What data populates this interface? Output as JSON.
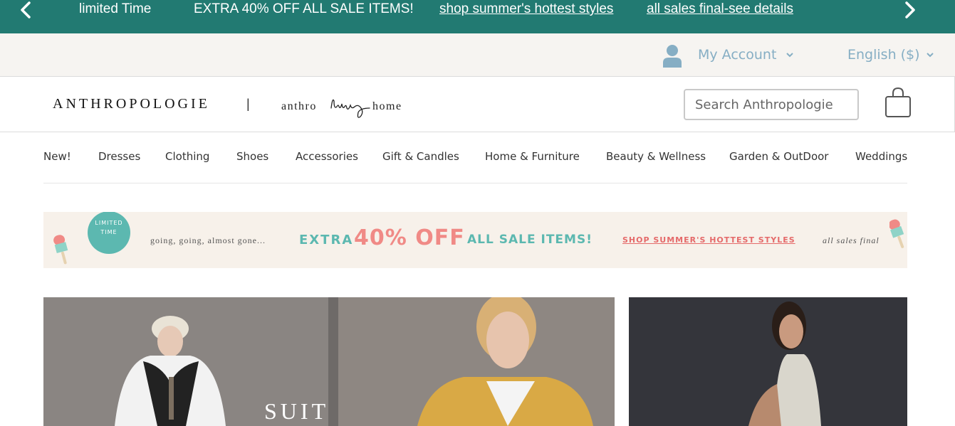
{
  "promo_bar": {
    "limited_label": "limited Time",
    "offer_label": "EXTRA 40% OFF ALL SALE ITEMS!",
    "shop_link": "shop summer's hottest styles",
    "details_link": "all sales final-see details",
    "prev_icon": "chevron-left-icon",
    "next_icon": "chevron-right-icon",
    "bg_color": "#227a72"
  },
  "utility_bar": {
    "account_label": "My Account",
    "account_icon": "user-icon",
    "language_label": "English ($)",
    "text_color": "#86aec4"
  },
  "header": {
    "logo_text": "ANTHROPOLOGIE",
    "separator": "|",
    "home_logo": "anthro living home",
    "search_placeholder": "Search Anthropologie",
    "cart_icon": "shopping-bag-icon"
  },
  "nav": {
    "items": [
      "New!",
      "Dresses",
      "Clothing",
      "Shoes",
      "Accessories",
      "Gift & Candles",
      "Home & Furniture",
      "Beauty & Wellness",
      "Garden & OutDoor",
      "Weddings"
    ]
  },
  "sale_banner": {
    "badge_line1": "LIMITED",
    "badge_line2": "TIME",
    "tagline": "going, going, almost gone...",
    "extra": "EXTRA",
    "percent": "40% OFF",
    "sale_items": "ALL SALE ITEMS!",
    "shop_link": "SHOP SUMMER'S HOTTEST STYLES",
    "final_note": "all sales final",
    "accent_teal": "#5cb8b0",
    "accent_pink": "#f08a86"
  },
  "hero": {
    "left_overlay_text": "SUIT"
  }
}
